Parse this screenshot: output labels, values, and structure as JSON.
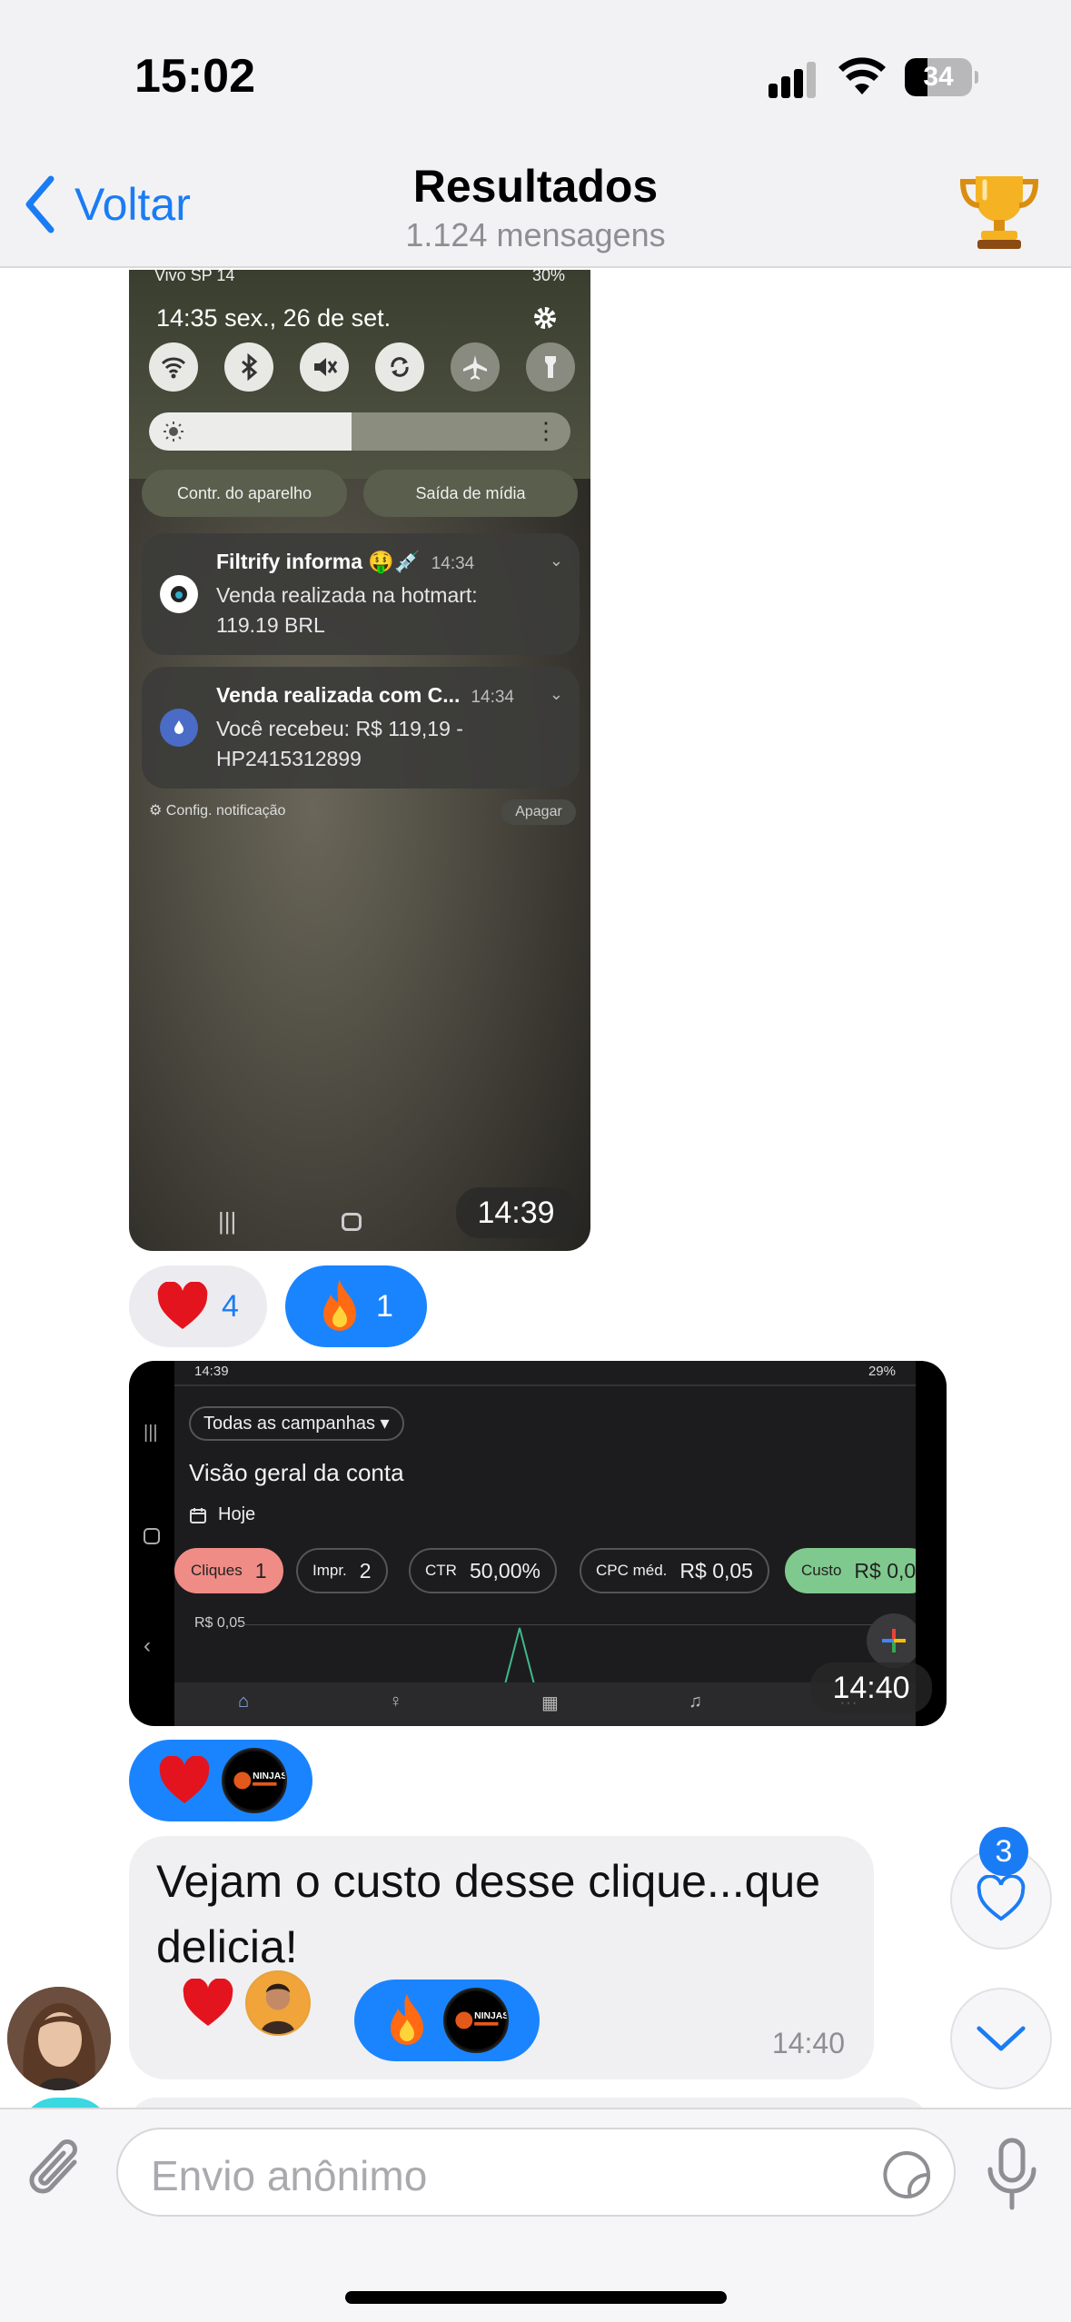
{
  "status_bar": {
    "time": "15:02",
    "battery": "34",
    "battery_level_percent": 34
  },
  "header": {
    "back_label": "Voltar",
    "title": "Resultados",
    "subtitle": "1.124 mensagens",
    "trophy_icon": "trophy-icon"
  },
  "screenshot1": {
    "carrier": "Vivo SP 14",
    "status_right": "30%",
    "datetime": "14:35  sex., 26 de set.",
    "quick_settings": [
      "wifi-icon",
      "bluetooth-icon",
      "mute-icon",
      "rotate-icon",
      "airplane-icon",
      "flashlight-icon"
    ],
    "brightness_level_percent": 48,
    "device_control_label": "Contr. do aparelho",
    "media_output_label": "Saída de mídia",
    "notifications": [
      {
        "title": "Filtrify informa 🤑💉",
        "time": "14:34",
        "body": "Venda realizada na hotmart: 119.19 BRL"
      },
      {
        "title": "Venda realizada com C...",
        "time": "14:34",
        "body": "Você recebeu: R$ 119,19 - HP2415312899"
      }
    ],
    "notif_settings_label": "Config. notificação",
    "clear_label": "Apagar",
    "nav_recent": "|||",
    "timestamp": "14:39"
  },
  "reactions1": [
    {
      "emoji": "heart",
      "count": "4",
      "selected": false
    },
    {
      "emoji": "fire",
      "count": "1",
      "selected": true
    }
  ],
  "screenshot2": {
    "status_left": "14:39",
    "status_right": "29%",
    "campaign_dropdown": "Todas as campanhas ▾",
    "heading": "Visão geral da conta",
    "date_range": "Hoje",
    "metrics": [
      {
        "key": "Cliques",
        "value": "1"
      },
      {
        "key": "Impr.",
        "value": "2"
      },
      {
        "key": "CTR",
        "value": "50,00%"
      },
      {
        "key": "CPC méd.",
        "value": "R$ 0,05"
      },
      {
        "key": "Custo",
        "value": "R$ 0,0"
      }
    ],
    "chart_label": "R$ 0,05",
    "side_recent": "|||",
    "timestamp": "14:40"
  },
  "reactions2": {
    "emoji": "heart",
    "avatar_label": "NINJAS"
  },
  "message": {
    "text": "Vejam o custo desse clique...que delicia!",
    "time": "14:40",
    "reactions": [
      {
        "emoji": "heart",
        "selected": false
      },
      {
        "emoji": "fire",
        "selected": true,
        "avatar_label": "NINJAS"
      }
    ]
  },
  "floating": {
    "likes_badge": "3"
  },
  "composer": {
    "placeholder": "Envio anônimo"
  }
}
